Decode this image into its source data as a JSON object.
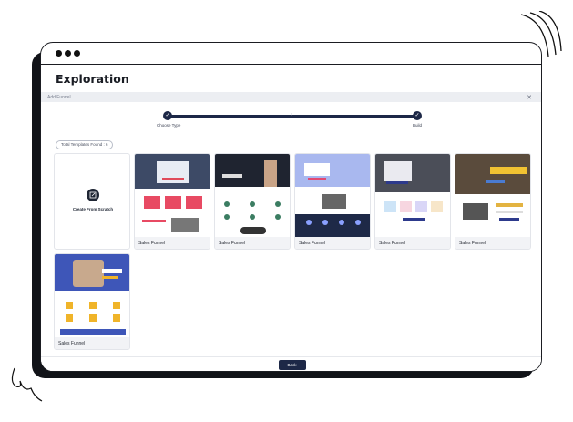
{
  "window": {
    "title": "Exploration"
  },
  "panel": {
    "title": "Add Funnel",
    "close_symbol": "✕"
  },
  "stepper": {
    "steps": [
      {
        "label": "Choose Type",
        "check": "✓"
      },
      {
        "label": "Build",
        "check": "✓"
      }
    ],
    "arrow": "›"
  },
  "templates": {
    "count_label": "Total Templates Found : 6",
    "scratch_label": "Create From Scratch",
    "cards": [
      {
        "label": "Sales Funnel"
      },
      {
        "label": "Sales Funnel"
      },
      {
        "label": "Sales Funnel"
      },
      {
        "label": "Sales Funnel"
      },
      {
        "label": "Sales Funnel"
      },
      {
        "label": "Sales Funnel"
      }
    ]
  },
  "footer": {
    "back_label": "Back"
  },
  "colors": {
    "accent": "#1d2847",
    "window_border": "#1b1d22",
    "bar": "#eceef2"
  }
}
